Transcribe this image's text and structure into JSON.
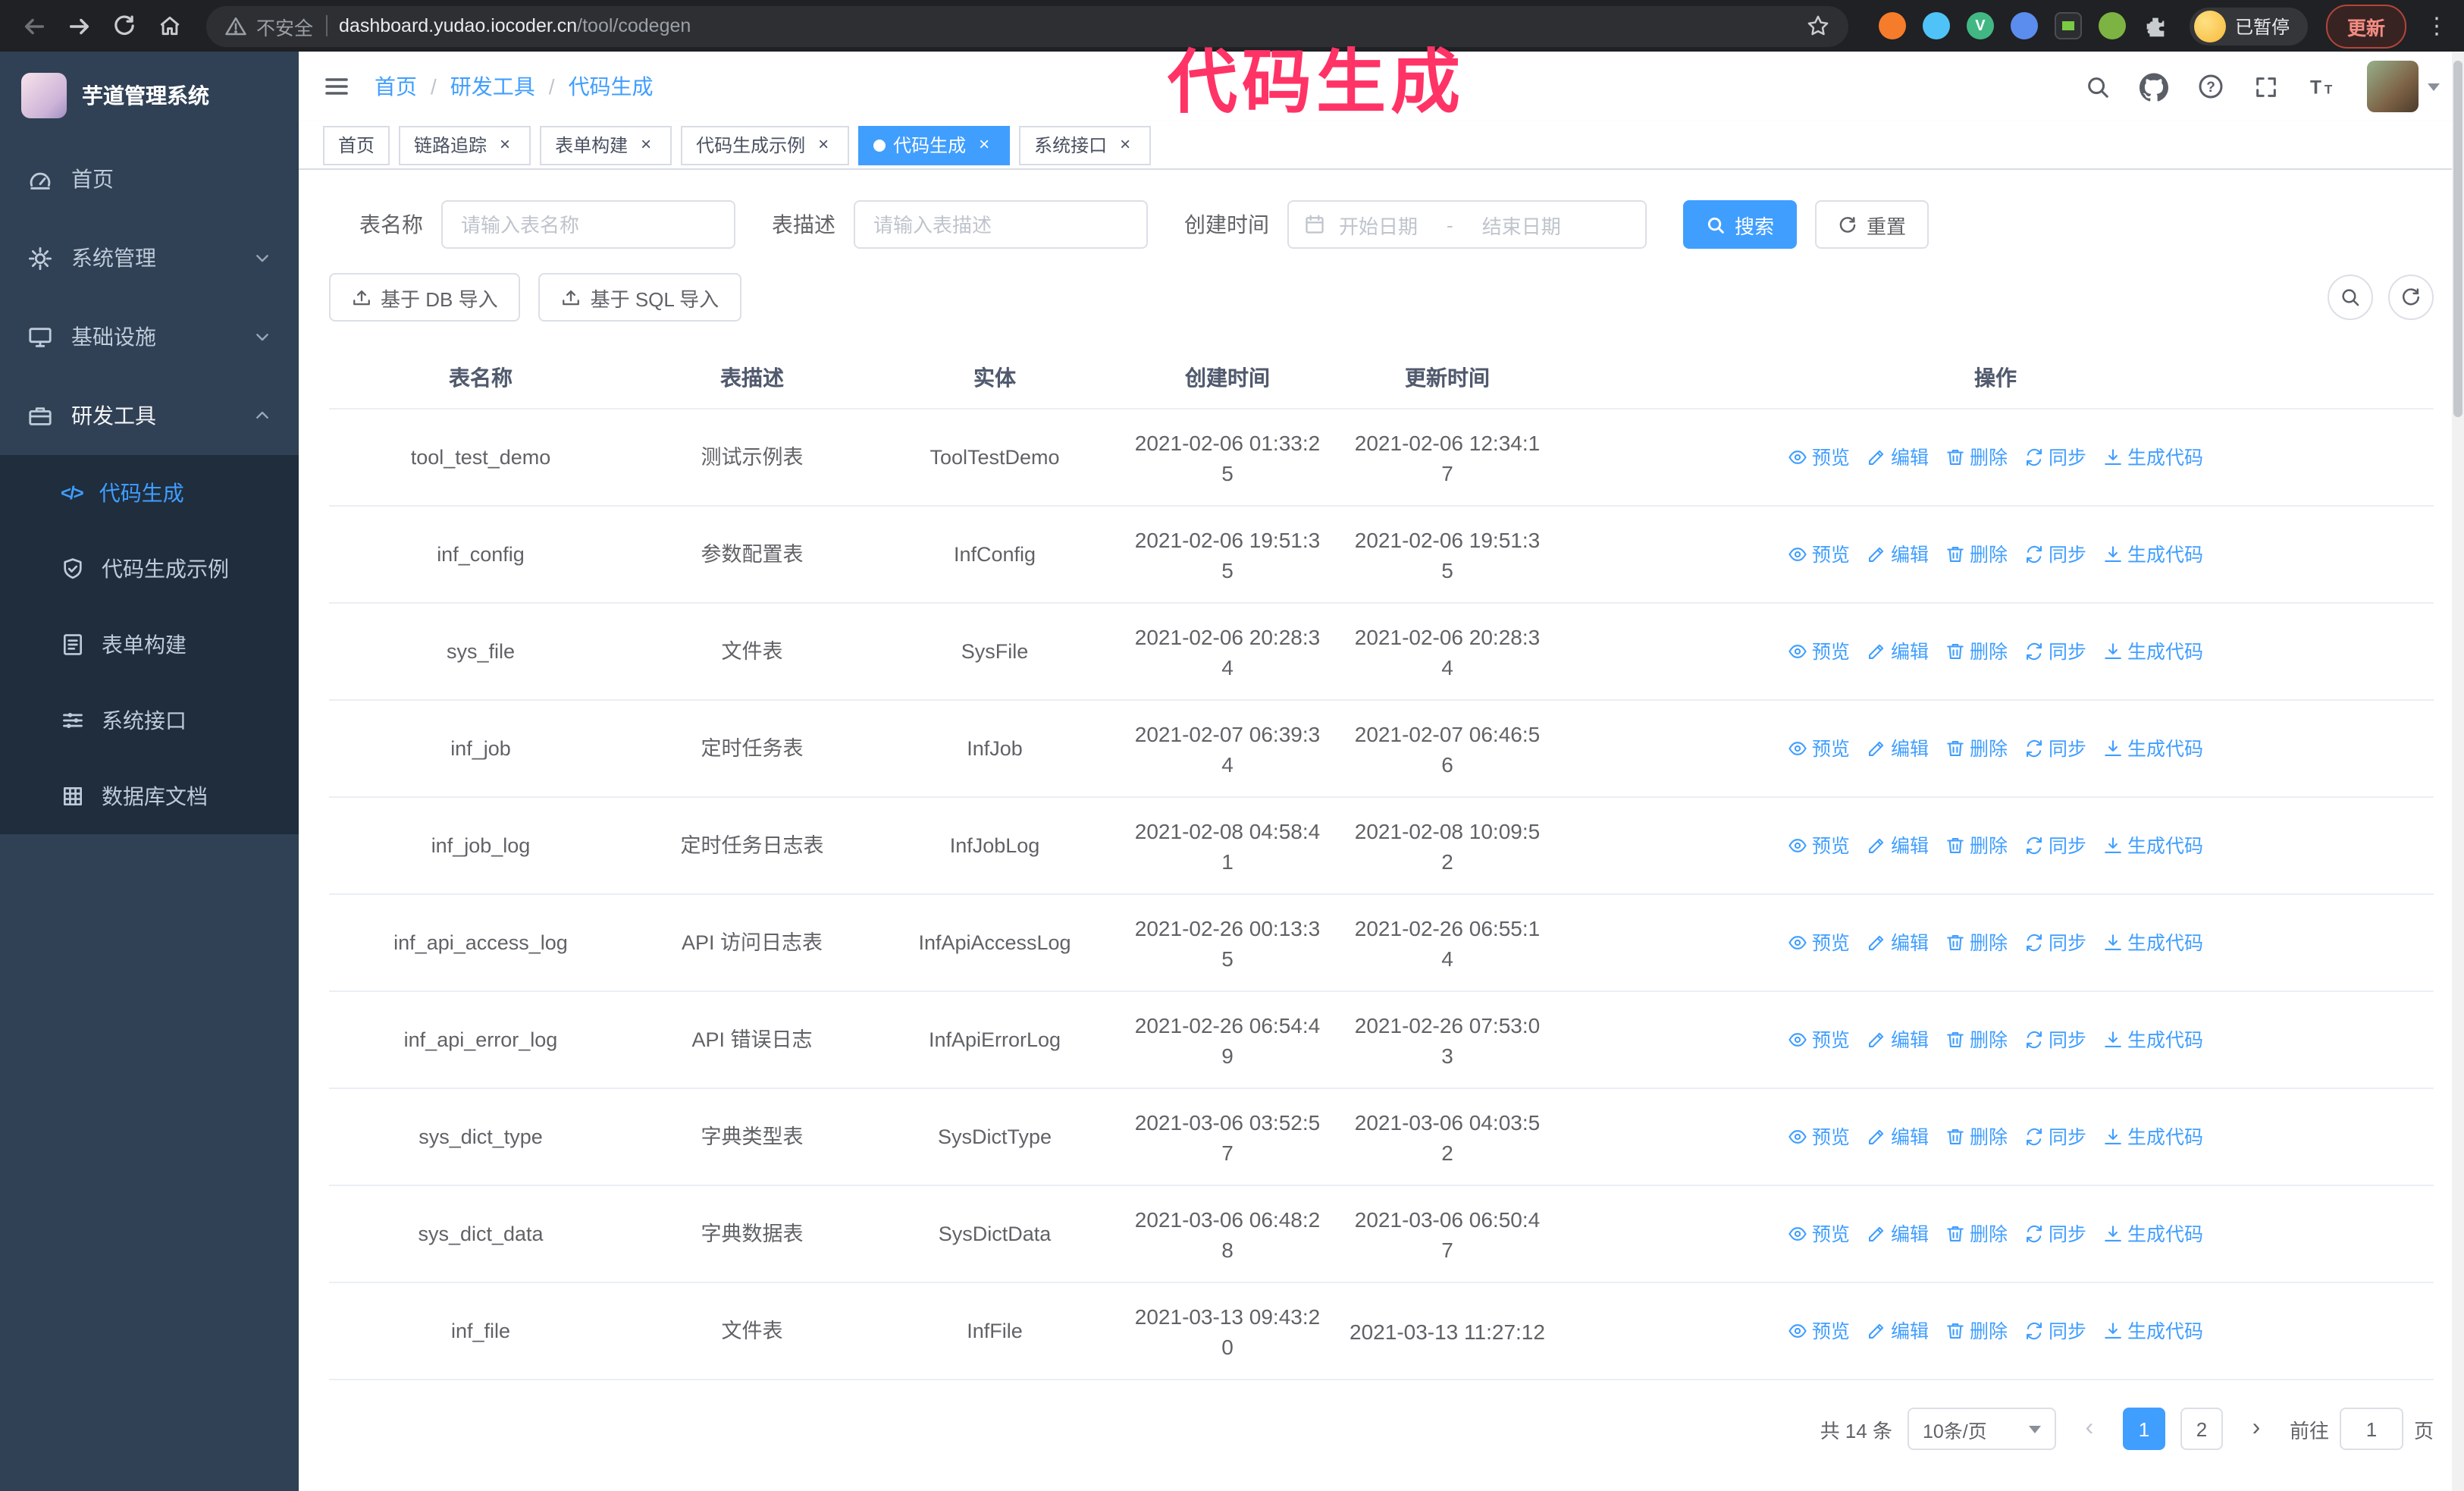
{
  "colors": {
    "accent": "#409eff",
    "annotation": "#ff3366",
    "sidebar_bg": "#304156",
    "submenu_bg": "#1f2d3d"
  },
  "icons": {
    "close": "×",
    "prev": "‹",
    "next": "›",
    "more": "⋮",
    "code_glyph": "</>"
  },
  "browser": {
    "insecure_label": "不安全",
    "url_domain": "dashboard.yudao.iocoder.cn",
    "url_path": "/tool/codegen",
    "vue_badge_letter": "V",
    "profile_badge": "已暂停",
    "update_button": "更新"
  },
  "annotation": {
    "text": "代码生成"
  },
  "sidebar": {
    "logo_title": "芋道管理系统",
    "menu": [
      {
        "label": "首页"
      },
      {
        "label": "系统管理"
      },
      {
        "label": "基础设施"
      },
      {
        "label": "研发工具"
      }
    ],
    "submenu": [
      {
        "label": "代码生成"
      },
      {
        "label": "代码生成示例"
      },
      {
        "label": "表单构建"
      },
      {
        "label": "系统接口"
      },
      {
        "label": "数据库文档"
      }
    ]
  },
  "breadcrumb": {
    "items": [
      "首页",
      "研发工具",
      "代码生成"
    ],
    "separator": "/"
  },
  "tabs": [
    {
      "label": "首页"
    },
    {
      "label": "链路追踪"
    },
    {
      "label": "表单构建"
    },
    {
      "label": "代码生成示例"
    },
    {
      "label": "代码生成"
    },
    {
      "label": "系统接口"
    }
  ],
  "filters": {
    "table_name_label": "表名称",
    "table_name_placeholder": "请输入表名称",
    "table_desc_label": "表描述",
    "table_desc_placeholder": "请输入表描述",
    "create_time_label": "创建时间",
    "start_date_placeholder": "开始日期",
    "range_separator": "-",
    "end_date_placeholder": "结束日期",
    "search_button": "搜索",
    "reset_button": "重置"
  },
  "toolbar": {
    "import_db_button": "基于 DB 导入",
    "import_sql_button": "基于 SQL 导入"
  },
  "table": {
    "columns": [
      "表名称",
      "表描述",
      "实体",
      "创建时间",
      "更新时间",
      "操作"
    ],
    "action_labels": [
      "预览",
      "编辑",
      "删除",
      "同步",
      "生成代码"
    ],
    "rows": [
      {
        "name": "tool_test_demo",
        "desc": "测试示例表",
        "entity": "ToolTestDemo",
        "created": "2021-02-06 01:33:25",
        "updated": "2021-02-06 12:34:17"
      },
      {
        "name": "inf_config",
        "desc": "参数配置表",
        "entity": "InfConfig",
        "created": "2021-02-06 19:51:35",
        "updated": "2021-02-06 19:51:35"
      },
      {
        "name": "sys_file",
        "desc": "文件表",
        "entity": "SysFile",
        "created": "2021-02-06 20:28:34",
        "updated": "2021-02-06 20:28:34"
      },
      {
        "name": "inf_job",
        "desc": "定时任务表",
        "entity": "InfJob",
        "created": "2021-02-07 06:39:34",
        "updated": "2021-02-07 06:46:56"
      },
      {
        "name": "inf_job_log",
        "desc": "定时任务日志表",
        "entity": "InfJobLog",
        "created": "2021-02-08 04:58:41",
        "updated": "2021-02-08 10:09:52"
      },
      {
        "name": "inf_api_access_log",
        "desc": "API 访问日志表",
        "entity": "InfApiAccessLog",
        "created": "2021-02-26 00:13:35",
        "updated": "2021-02-26 06:55:14"
      },
      {
        "name": "inf_api_error_log",
        "desc": "API 错误日志",
        "entity": "InfApiErrorLog",
        "created": "2021-02-26 06:54:49",
        "updated": "2021-02-26 07:53:03"
      },
      {
        "name": "sys_dict_type",
        "desc": "字典类型表",
        "entity": "SysDictType",
        "created": "2021-03-06 03:52:57",
        "updated": "2021-03-06 04:03:52"
      },
      {
        "name": "sys_dict_data",
        "desc": "字典数据表",
        "entity": "SysDictData",
        "created": "2021-03-06 06:48:28",
        "updated": "2021-03-06 06:50:47"
      },
      {
        "name": "inf_file",
        "desc": "文件表",
        "entity": "InfFile",
        "created": "2021-03-13 09:43:20",
        "updated": "2021-03-13 11:27:12"
      }
    ]
  },
  "pagination": {
    "total_text": "共 14 条",
    "page_size": "10条/页",
    "pages": [
      "1",
      "2"
    ],
    "active_page": "1",
    "goto_label": "前往",
    "goto_value": "1",
    "goto_unit": "页"
  }
}
